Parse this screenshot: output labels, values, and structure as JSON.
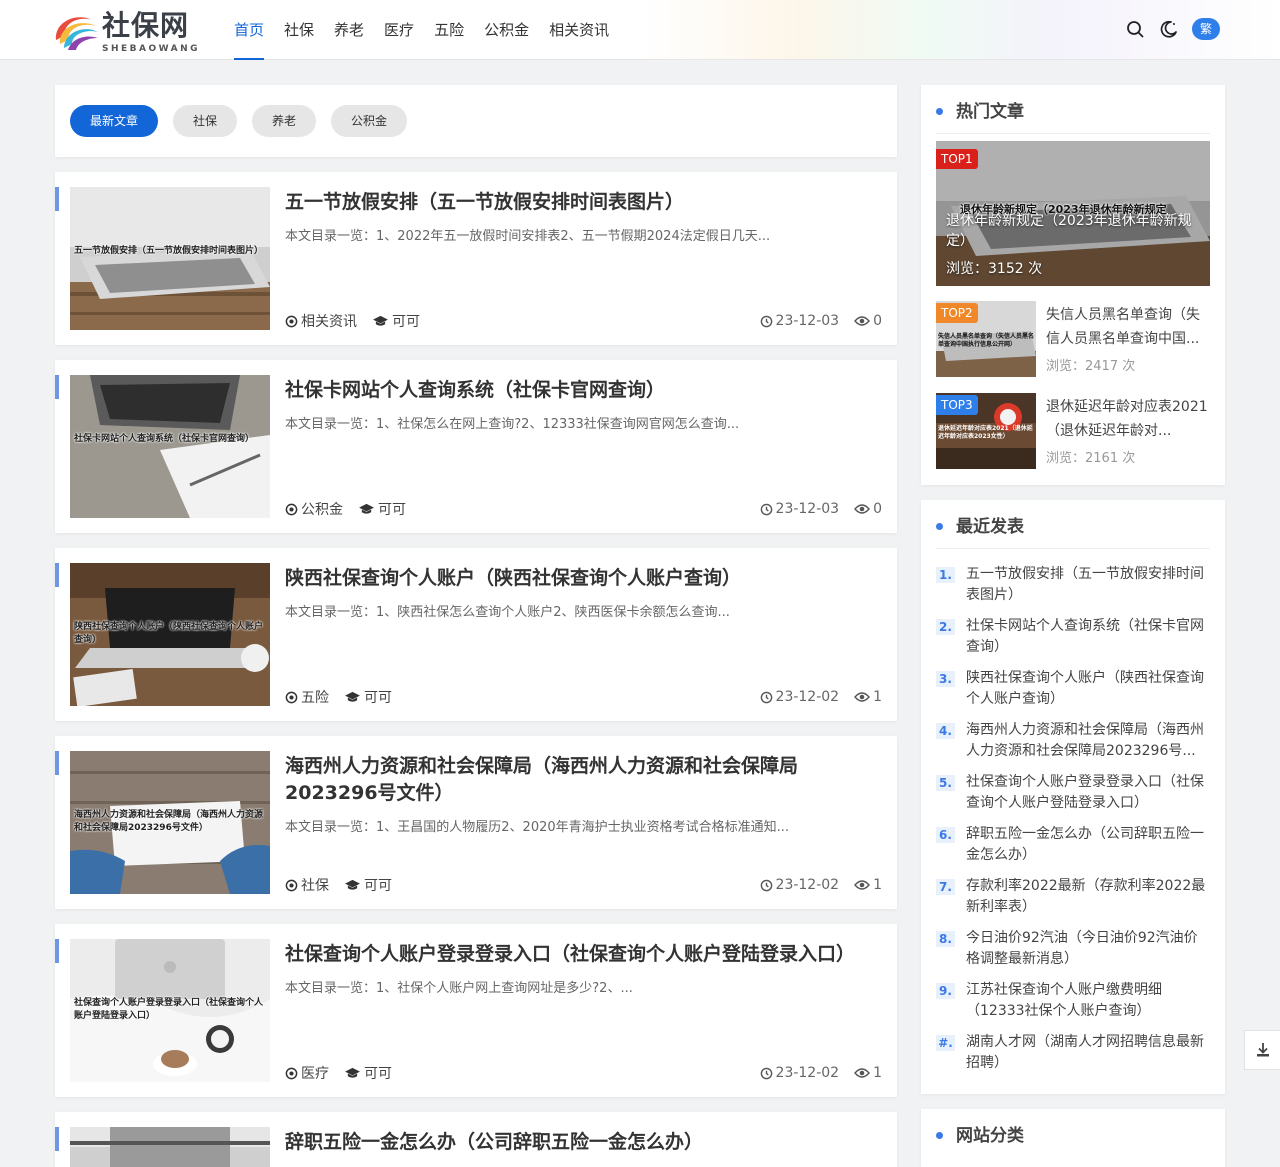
{
  "site": {
    "logo_text": "社保网",
    "logo_sub": "SHEBAOWANG",
    "brand_color": "#1266d8"
  },
  "nav": {
    "items": [
      {
        "label": "首页",
        "active": true
      },
      {
        "label": "社保"
      },
      {
        "label": "养老"
      },
      {
        "label": "医疗"
      },
      {
        "label": "五险"
      },
      {
        "label": "公积金"
      },
      {
        "label": "相关资讯"
      }
    ],
    "icons": [
      "search-icon",
      "dark-mode-icon"
    ],
    "lang_label": "繁"
  },
  "tabs": [
    "最新文章",
    "社保",
    "养老",
    "公积金"
  ],
  "posts": [
    {
      "title": "五一节放假安排（五一节放假安排时间表图片）",
      "thumb_caption": "五一节放假安排（五一节放假安排时间表图片）",
      "excerpt": "本文目录一览：1、2022年五一放假时间安排表2、五一节假期2024法定假日几天...",
      "category": "相关资讯",
      "author": "可可",
      "date": "23-12-03",
      "views": "0"
    },
    {
      "title": "社保卡网站个人查询系统（社保卡官网查询）",
      "thumb_caption": "社保卡网站个人查询系统（社保卡官网查询）",
      "excerpt": "本文目录一览：1、社保怎么在网上查询?2、12333社保查询网官网怎么查询...",
      "category": "公积金",
      "author": "可可",
      "date": "23-12-03",
      "views": "0"
    },
    {
      "title": "陕西社保查询个人账户（陕西社保查询个人账户查询）",
      "thumb_caption": "陕西社保查询个人账户（陕西社保查询个人账户查询）",
      "excerpt": "本文目录一览：1、陕西社保怎么查询个人账户2、陕西医保卡余额怎么查询...",
      "category": "五险",
      "author": "可可",
      "date": "23-12-02",
      "views": "1"
    },
    {
      "title": "海西州人力资源和社会保障局（海西州人力资源和社会保障局2023296号文件）",
      "thumb_caption": "海西州人力资源和社会保障局（海西州人力资源和社会保障局2023296号文件）",
      "excerpt": "本文目录一览：1、王昌国的人物履历2、2020年青海护士执业资格考试合格标准通知...",
      "category": "社保",
      "author": "可可",
      "date": "23-12-02",
      "views": "1"
    },
    {
      "title": "社保查询个人账户登录登录入口（社保查询个人账户登陆登录入口）",
      "thumb_caption": "社保查询个人账户登录登录入口（社保查询个人账户登陆登录入口）",
      "excerpt": "本文目录一览：1、社保个人账户网上查询网址是多少?2、...",
      "category": "医疗",
      "author": "可可",
      "date": "23-12-02",
      "views": "1"
    },
    {
      "title": "辞职五险一金怎么办（公司辞职五险一金怎么办）",
      "thumb_caption": "",
      "excerpt": "",
      "category": "",
      "author": "",
      "date": "",
      "views": ""
    }
  ],
  "hot": {
    "title": "热门文章",
    "items": [
      {
        "badge": "TOP1",
        "title": "退休年龄新规定（2023年退休年龄新规定）",
        "thumb_caption": "退休年龄新规定（2023年退休年龄新规定",
        "views": "浏览：3152 次",
        "badge_color": "#d9201a"
      },
      {
        "badge": "TOP2",
        "title": "失信人员黑名单查询（失信人员黑名单查询中国...",
        "thumb_caption": "失信人员黑名单查询（失信人员黑名单查询中国执行信息公开网）",
        "views": "浏览：2417 次",
        "badge_color": "#f0882a"
      },
      {
        "badge": "TOP3",
        "title": "退休延迟年龄对应表2021（退休延迟年龄对...",
        "thumb_caption": "退休延迟年龄对应表2021（退休延迟年龄对应表2023女性）",
        "views": "浏览：2161 次",
        "badge_color": "#2f7fea"
      }
    ]
  },
  "recent": {
    "title": "最近发表",
    "items": [
      {
        "num": "1.",
        "title": "五一节放假安排（五一节放假安排时间表图片）"
      },
      {
        "num": "2.",
        "title": "社保卡网站个人查询系统（社保卡官网查询）"
      },
      {
        "num": "3.",
        "title": "陕西社保查询个人账户（陕西社保查询个人账户查询）"
      },
      {
        "num": "4.",
        "title": "海西州人力资源和社会保障局（海西州人力资源和社会保障局2023296号..."
      },
      {
        "num": "5.",
        "title": "社保查询个人账户登录登录入口（社保查询个人账户登陆登录入口）"
      },
      {
        "num": "6.",
        "title": "辞职五险一金怎么办（公司辞职五险一金怎么办）"
      },
      {
        "num": "7.",
        "title": "存款利率2022最新（存款利率2022最新利率表）"
      },
      {
        "num": "8.",
        "title": "今日油价92汽油（今日油价92汽油价格调整最新消息）"
      },
      {
        "num": "9.",
        "title": "江苏社保查询个人账户缴费明细（12333社保个人账户查询）"
      },
      {
        "num": "#.",
        "title": "湖南人才网（湖南人才网招聘信息最新招聘）"
      }
    ]
  },
  "categories": {
    "title": "网站分类"
  }
}
